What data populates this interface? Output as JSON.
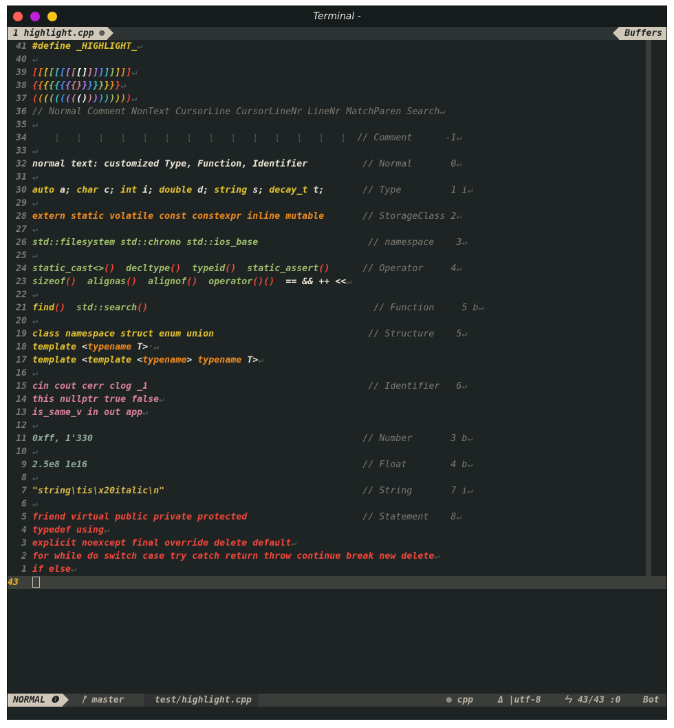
{
  "window": {
    "title": "Terminal -"
  },
  "tabline": {
    "tab_label": "1 highlight.cpp ⊕",
    "buffers_label": "Buffers"
  },
  "statusbar": {
    "mode": "NORMAL ❶",
    "branch": "ᚠ master",
    "file": "test/highlight.cpp",
    "filetype": "⊕ cpp",
    "encoding": "Δ |utf-8",
    "position": "ㄣ 43/43 :0",
    "scroll": "Bot"
  },
  "colors": {
    "background": "#1e2424",
    "keyword_red": "#f2473a",
    "storage_orange": "#f08a1f",
    "type_yellow": "#e3c22e",
    "function_green": "#9fbd6a",
    "string_yellow": "#d6b84a",
    "identifier_pink": "#d8809a",
    "number_teal": "#8fae9a",
    "comment_gray": "#7d7a70",
    "line_number_current": "#f5b622"
  },
  "lines": [
    {
      "nr": "41",
      "segs": [
        {
          "t": "#define _HIGHLIGHT_",
          "c": "#e3c22e"
        }
      ]
    },
    {
      "nr": "40",
      "segs": []
    },
    {
      "nr": "39",
      "segs": [
        {
          "t": "[[[[[[[[[]]]]]]]]]",
          "c": "rainbow"
        }
      ]
    },
    {
      "nr": "38",
      "segs": [
        {
          "t": "{{{{{{{{}}}}}}}}",
          "c": "rainbow"
        }
      ]
    },
    {
      "nr": "37",
      "segs": [
        {
          "t": "((((((((()))))))))",
          "c": "rainbow"
        }
      ]
    },
    {
      "nr": "36",
      "segs": [
        {
          "t": "// Normal Comment NonText CursorLine CursorLineNr LineNr MatchParen Search",
          "c": "#7d7a70"
        }
      ]
    },
    {
      "nr": "35",
      "segs": []
    },
    {
      "nr": "34",
      "segs": [
        {
          "t": "    ¦   ¦   ¦   ¦   ¦   ¦   ¦   ¦   ¦   ¦   ¦   ¦   ¦   ¦  ",
          "c": "#4d504c"
        },
        {
          "t": "// Comment      -1",
          "c": "#7d7a70"
        }
      ]
    },
    {
      "nr": "33",
      "segs": []
    },
    {
      "nr": "32",
      "segs": [
        {
          "t": "normal text: customized Type, Function, Identifier          ",
          "c": "#e8e2d2"
        },
        {
          "t": "// Normal       0",
          "c": "#7d7a70"
        }
      ]
    },
    {
      "nr": "31",
      "segs": []
    },
    {
      "nr": "30",
      "segs": [
        {
          "t": "auto",
          "c": "#e3c22e"
        },
        {
          "t": " a; ",
          "c": "#e8e2d2"
        },
        {
          "t": "char",
          "c": "#e3c22e"
        },
        {
          "t": " c; ",
          "c": "#e8e2d2"
        },
        {
          "t": "int",
          "c": "#e3c22e"
        },
        {
          "t": " i; ",
          "c": "#e8e2d2"
        },
        {
          "t": "double",
          "c": "#e3c22e"
        },
        {
          "t": " d; ",
          "c": "#e8e2d2"
        },
        {
          "t": "string",
          "c": "#e3c22e"
        },
        {
          "t": " s; ",
          "c": "#e8e2d2"
        },
        {
          "t": "decay_t",
          "c": "#e3c22e"
        },
        {
          "t": " t;       ",
          "c": "#e8e2d2"
        },
        {
          "t": "// Type         1 i",
          "c": "#7d7a70"
        }
      ]
    },
    {
      "nr": "29",
      "segs": []
    },
    {
      "nr": "28",
      "segs": [
        {
          "t": "extern static volatile const constexpr inline mutable       ",
          "c": "#f08a1f"
        },
        {
          "t": "// StorageClass 2",
          "c": "#7d7a70"
        }
      ]
    },
    {
      "nr": "27",
      "segs": []
    },
    {
      "nr": "26",
      "segs": [
        {
          "t": "std::filesystem std::chrono std::ios_base                    ",
          "c": "#9fbd6a"
        },
        {
          "t": "// namespace    3",
          "c": "#7d7a70"
        }
      ]
    },
    {
      "nr": "25",
      "segs": []
    },
    {
      "nr": "24",
      "segs": [
        {
          "t": "static_cast<>",
          "c": "#9fbd6a"
        },
        {
          "t": "()",
          "c": "#f2473a"
        },
        {
          "t": "  decltype",
          "c": "#9fbd6a"
        },
        {
          "t": "()",
          "c": "#f2473a"
        },
        {
          "t": "  typeid",
          "c": "#9fbd6a"
        },
        {
          "t": "()",
          "c": "#f2473a"
        },
        {
          "t": "  static_assert",
          "c": "#9fbd6a"
        },
        {
          "t": "()",
          "c": "#f2473a"
        },
        {
          "t": "      ",
          "c": "#e8e2d2"
        },
        {
          "t": "// Operator     4",
          "c": "#7d7a70"
        }
      ]
    },
    {
      "nr": "23",
      "segs": [
        {
          "t": "sizeof",
          "c": "#9fbd6a"
        },
        {
          "t": "()",
          "c": "#f2473a"
        },
        {
          "t": "  alignas",
          "c": "#9fbd6a"
        },
        {
          "t": "()",
          "c": "#f2473a"
        },
        {
          "t": "  alignof",
          "c": "#9fbd6a"
        },
        {
          "t": "()",
          "c": "#f2473a"
        },
        {
          "t": "  operator",
          "c": "#9fbd6a"
        },
        {
          "t": "()()",
          "c": "#f2473a"
        },
        {
          "t": "  == && ++ <<",
          "c": "#e8e2d2"
        }
      ]
    },
    {
      "nr": "22",
      "segs": []
    },
    {
      "nr": "21",
      "segs": [
        {
          "t": "find",
          "c": "#e3c22e"
        },
        {
          "t": "()",
          "c": "#f2473a"
        },
        {
          "t": "  std::search",
          "c": "#9fbd6a"
        },
        {
          "t": "()",
          "c": "#f2473a"
        },
        {
          "t": "                                         ",
          "c": "#e8e2d2"
        },
        {
          "t": "// Function     5 b",
          "c": "#7d7a70"
        }
      ]
    },
    {
      "nr": "20",
      "segs": []
    },
    {
      "nr": "19",
      "segs": [
        {
          "t": "class namespace struct enum union                            ",
          "c": "#e3c22e"
        },
        {
          "t": "// Structure    5",
          "c": "#7d7a70"
        }
      ]
    },
    {
      "nr": "18",
      "segs": [
        {
          "t": "template ",
          "c": "#e3c22e"
        },
        {
          "t": "<",
          "c": "#e8e2d2"
        },
        {
          "t": "typename",
          "c": "#f08a1f"
        },
        {
          "t": " T>",
          "c": "#e8e2d2"
        },
        {
          "t": "·",
          "c": "#5b5f5c"
        }
      ]
    },
    {
      "nr": "17",
      "segs": [
        {
          "t": "template ",
          "c": "#e3c22e"
        },
        {
          "t": "<",
          "c": "#e8e2d2"
        },
        {
          "t": "template ",
          "c": "#e3c22e"
        },
        {
          "t": "<",
          "c": "#e8e2d2"
        },
        {
          "t": "typename",
          "c": "#f08a1f"
        },
        {
          "t": "> ",
          "c": "#e8e2d2"
        },
        {
          "t": "typename",
          "c": "#f08a1f"
        },
        {
          "t": " T>",
          "c": "#e8e2d2"
        }
      ]
    },
    {
      "nr": "16",
      "segs": []
    },
    {
      "nr": "15",
      "segs": [
        {
          "t": "cin cout cerr clog _1                                        ",
          "c": "#d8809a"
        },
        {
          "t": "// Identifier   6",
          "c": "#7d7a70"
        }
      ]
    },
    {
      "nr": "14",
      "segs": [
        {
          "t": "this nullptr true false",
          "c": "#d8809a"
        }
      ]
    },
    {
      "nr": "13",
      "segs": [
        {
          "t": "is_same_v in out app",
          "c": "#d8809a"
        }
      ]
    },
    {
      "nr": "12",
      "segs": []
    },
    {
      "nr": "11",
      "segs": [
        {
          "t": "0xff, 1'330                                                 ",
          "c": "#8fae9a"
        },
        {
          "t": "// Number       3 b",
          "c": "#7d7a70"
        }
      ]
    },
    {
      "nr": "10",
      "segs": []
    },
    {
      "nr": "9",
      "segs": [
        {
          "t": "2.5e8 1e16                                                  ",
          "c": "#8fae9a"
        },
        {
          "t": "// Float        4 b",
          "c": "#7d7a70"
        }
      ]
    },
    {
      "nr": "8",
      "segs": []
    },
    {
      "nr": "7",
      "segs": [
        {
          "t": "\"string\\tis\\x20italic\\n\"                                    ",
          "c": "#d6b84a"
        },
        {
          "t": "// String       7 i",
          "c": "#7d7a70"
        }
      ]
    },
    {
      "nr": "6",
      "segs": []
    },
    {
      "nr": "5",
      "segs": [
        {
          "t": "friend virtual public private protected                     ",
          "c": "#f2473a"
        },
        {
          "t": "// Statement    8",
          "c": "#7d7a70"
        }
      ]
    },
    {
      "nr": "4",
      "segs": [
        {
          "t": "typedef using",
          "c": "#f2473a"
        }
      ]
    },
    {
      "nr": "3",
      "segs": [
        {
          "t": "explicit noexcept final override delete default",
          "c": "#f2473a"
        }
      ]
    },
    {
      "nr": "2",
      "segs": [
        {
          "t": "for while do switch case try catch return throw continue break new delete",
          "c": "#f2473a"
        }
      ]
    },
    {
      "nr": "1",
      "segs": [
        {
          "t": "if else",
          "c": "#f2473a"
        }
      ]
    },
    {
      "nr": "43",
      "segs": [],
      "current": true
    }
  ]
}
